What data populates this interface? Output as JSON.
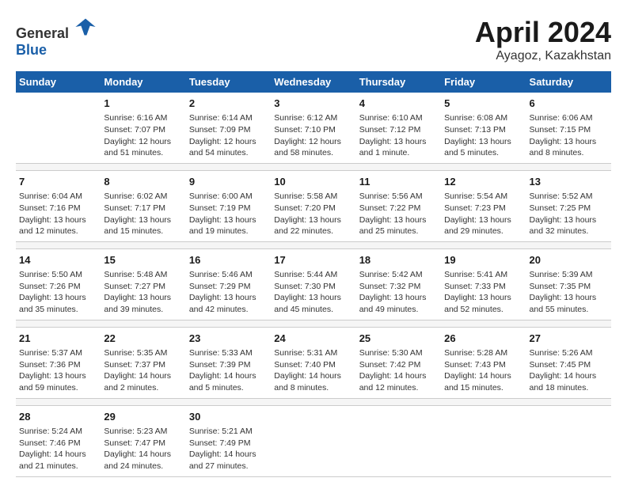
{
  "header": {
    "logo_general": "General",
    "logo_blue": "Blue",
    "title": "April 2024",
    "subtitle": "Ayagoz, Kazakhstan"
  },
  "columns": [
    "Sunday",
    "Monday",
    "Tuesday",
    "Wednesday",
    "Thursday",
    "Friday",
    "Saturday"
  ],
  "weeks": [
    [
      {
        "day": "",
        "sunrise": "",
        "sunset": "",
        "daylight": ""
      },
      {
        "day": "1",
        "sunrise": "Sunrise: 6:16 AM",
        "sunset": "Sunset: 7:07 PM",
        "daylight": "Daylight: 12 hours and 51 minutes."
      },
      {
        "day": "2",
        "sunrise": "Sunrise: 6:14 AM",
        "sunset": "Sunset: 7:09 PM",
        "daylight": "Daylight: 12 hours and 54 minutes."
      },
      {
        "day": "3",
        "sunrise": "Sunrise: 6:12 AM",
        "sunset": "Sunset: 7:10 PM",
        "daylight": "Daylight: 12 hours and 58 minutes."
      },
      {
        "day": "4",
        "sunrise": "Sunrise: 6:10 AM",
        "sunset": "Sunset: 7:12 PM",
        "daylight": "Daylight: 13 hours and 1 minute."
      },
      {
        "day": "5",
        "sunrise": "Sunrise: 6:08 AM",
        "sunset": "Sunset: 7:13 PM",
        "daylight": "Daylight: 13 hours and 5 minutes."
      },
      {
        "day": "6",
        "sunrise": "Sunrise: 6:06 AM",
        "sunset": "Sunset: 7:15 PM",
        "daylight": "Daylight: 13 hours and 8 minutes."
      }
    ],
    [
      {
        "day": "7",
        "sunrise": "Sunrise: 6:04 AM",
        "sunset": "Sunset: 7:16 PM",
        "daylight": "Daylight: 13 hours and 12 minutes."
      },
      {
        "day": "8",
        "sunrise": "Sunrise: 6:02 AM",
        "sunset": "Sunset: 7:17 PM",
        "daylight": "Daylight: 13 hours and 15 minutes."
      },
      {
        "day": "9",
        "sunrise": "Sunrise: 6:00 AM",
        "sunset": "Sunset: 7:19 PM",
        "daylight": "Daylight: 13 hours and 19 minutes."
      },
      {
        "day": "10",
        "sunrise": "Sunrise: 5:58 AM",
        "sunset": "Sunset: 7:20 PM",
        "daylight": "Daylight: 13 hours and 22 minutes."
      },
      {
        "day": "11",
        "sunrise": "Sunrise: 5:56 AM",
        "sunset": "Sunset: 7:22 PM",
        "daylight": "Daylight: 13 hours and 25 minutes."
      },
      {
        "day": "12",
        "sunrise": "Sunrise: 5:54 AM",
        "sunset": "Sunset: 7:23 PM",
        "daylight": "Daylight: 13 hours and 29 minutes."
      },
      {
        "day": "13",
        "sunrise": "Sunrise: 5:52 AM",
        "sunset": "Sunset: 7:25 PM",
        "daylight": "Daylight: 13 hours and 32 minutes."
      }
    ],
    [
      {
        "day": "14",
        "sunrise": "Sunrise: 5:50 AM",
        "sunset": "Sunset: 7:26 PM",
        "daylight": "Daylight: 13 hours and 35 minutes."
      },
      {
        "day": "15",
        "sunrise": "Sunrise: 5:48 AM",
        "sunset": "Sunset: 7:27 PM",
        "daylight": "Daylight: 13 hours and 39 minutes."
      },
      {
        "day": "16",
        "sunrise": "Sunrise: 5:46 AM",
        "sunset": "Sunset: 7:29 PM",
        "daylight": "Daylight: 13 hours and 42 minutes."
      },
      {
        "day": "17",
        "sunrise": "Sunrise: 5:44 AM",
        "sunset": "Sunset: 7:30 PM",
        "daylight": "Daylight: 13 hours and 45 minutes."
      },
      {
        "day": "18",
        "sunrise": "Sunrise: 5:42 AM",
        "sunset": "Sunset: 7:32 PM",
        "daylight": "Daylight: 13 hours and 49 minutes."
      },
      {
        "day": "19",
        "sunrise": "Sunrise: 5:41 AM",
        "sunset": "Sunset: 7:33 PM",
        "daylight": "Daylight: 13 hours and 52 minutes."
      },
      {
        "day": "20",
        "sunrise": "Sunrise: 5:39 AM",
        "sunset": "Sunset: 7:35 PM",
        "daylight": "Daylight: 13 hours and 55 minutes."
      }
    ],
    [
      {
        "day": "21",
        "sunrise": "Sunrise: 5:37 AM",
        "sunset": "Sunset: 7:36 PM",
        "daylight": "Daylight: 13 hours and 59 minutes."
      },
      {
        "day": "22",
        "sunrise": "Sunrise: 5:35 AM",
        "sunset": "Sunset: 7:37 PM",
        "daylight": "Daylight: 14 hours and 2 minutes."
      },
      {
        "day": "23",
        "sunrise": "Sunrise: 5:33 AM",
        "sunset": "Sunset: 7:39 PM",
        "daylight": "Daylight: 14 hours and 5 minutes."
      },
      {
        "day": "24",
        "sunrise": "Sunrise: 5:31 AM",
        "sunset": "Sunset: 7:40 PM",
        "daylight": "Daylight: 14 hours and 8 minutes."
      },
      {
        "day": "25",
        "sunrise": "Sunrise: 5:30 AM",
        "sunset": "Sunset: 7:42 PM",
        "daylight": "Daylight: 14 hours and 12 minutes."
      },
      {
        "day": "26",
        "sunrise": "Sunrise: 5:28 AM",
        "sunset": "Sunset: 7:43 PM",
        "daylight": "Daylight: 14 hours and 15 minutes."
      },
      {
        "day": "27",
        "sunrise": "Sunrise: 5:26 AM",
        "sunset": "Sunset: 7:45 PM",
        "daylight": "Daylight: 14 hours and 18 minutes."
      }
    ],
    [
      {
        "day": "28",
        "sunrise": "Sunrise: 5:24 AM",
        "sunset": "Sunset: 7:46 PM",
        "daylight": "Daylight: 14 hours and 21 minutes."
      },
      {
        "day": "29",
        "sunrise": "Sunrise: 5:23 AM",
        "sunset": "Sunset: 7:47 PM",
        "daylight": "Daylight: 14 hours and 24 minutes."
      },
      {
        "day": "30",
        "sunrise": "Sunrise: 5:21 AM",
        "sunset": "Sunset: 7:49 PM",
        "daylight": "Daylight: 14 hours and 27 minutes."
      },
      {
        "day": "",
        "sunrise": "",
        "sunset": "",
        "daylight": ""
      },
      {
        "day": "",
        "sunrise": "",
        "sunset": "",
        "daylight": ""
      },
      {
        "day": "",
        "sunrise": "",
        "sunset": "",
        "daylight": ""
      },
      {
        "day": "",
        "sunrise": "",
        "sunset": "",
        "daylight": ""
      }
    ]
  ]
}
